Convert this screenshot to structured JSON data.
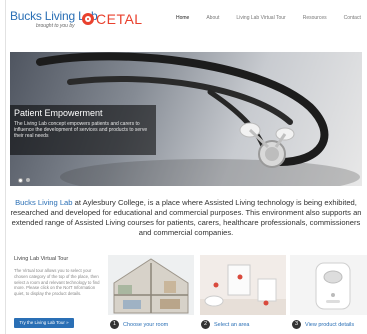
{
  "header": {
    "logo_title": "Bucks Living Lab",
    "logo_subtitle": "brought to you by",
    "partner_logo": "CETAL",
    "nav": [
      "Home",
      "About",
      "Living Lab Virtual Tour",
      "Resources",
      "Contact"
    ],
    "active_nav": "Home"
  },
  "hero": {
    "caption_title": "Patient Empowerment",
    "caption_text": "The Living Lab concept empowers patients and carers to influence the development of services and products to serve their real needs",
    "slides": 2,
    "active_slide": 1
  },
  "intro": {
    "link_text": "Bucks Living Lab",
    "text": " at Aylesbury College, is a place where Assisted Living technology is being exhibited, researched and developed for educational and commercial purposes. This environment also supports an extended range of Assisted Living courses for patients, carers, healthcare professionals, commissioners and commercial companies."
  },
  "tour": {
    "heading": "Living Lab Virtual Tour",
    "description": "The Virtual tour allows you to select your chosen category of the top of the place, then select a room and relevant technology to find more. Please click on the NoIT Information quiet, to display the product details.",
    "button_label": "Try the Living Lab Tour »"
  },
  "steps": [
    {
      "number": "1",
      "label": "Choose your room"
    },
    {
      "number": "2",
      "label": "Select an area"
    },
    {
      "number": "3",
      "label": "View product details"
    }
  ],
  "colors": {
    "brand_blue": "#2a6fb5",
    "cetal_red": "#e9412e"
  }
}
